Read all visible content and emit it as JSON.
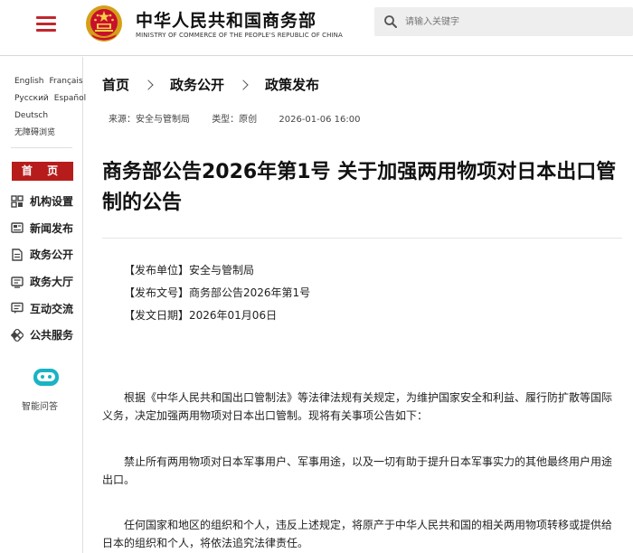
{
  "header": {
    "site_title_cn": "中华人民共和国商务部",
    "site_title_en": "MINISTRY OF COMMERCE OF THE PEOPLE'S REPUBLIC OF CHINA",
    "search_placeholder": "请输入关键字",
    "accent_color": "#c0272d"
  },
  "sidebar": {
    "languages": [
      [
        "English",
        "Français"
      ],
      [
        "Русский",
        "Español"
      ],
      [
        "Deutsch"
      ],
      [
        "无障碍浏览"
      ]
    ],
    "home": "首 页",
    "items": [
      {
        "label": "机构设置",
        "icon": "grid-icon"
      },
      {
        "label": "新闻发布",
        "icon": "newspaper-icon"
      },
      {
        "label": "政务公开",
        "icon": "document-icon"
      },
      {
        "label": "政务大厅",
        "icon": "form-icon"
      },
      {
        "label": "互动交流",
        "icon": "chat-icon"
      },
      {
        "label": "公共服务",
        "icon": "service-icon"
      }
    ],
    "ai_label": "智能问答"
  },
  "breadcrumb": [
    "首页",
    "政务公开",
    "政策发布"
  ],
  "meta": {
    "source": "来源：安全与管制局",
    "type": "类型：原创",
    "date": "2026-01-06 16:00"
  },
  "article": {
    "title": "商务部公告2026年第1号 关于加强两用物项对日本出口管制的公告",
    "info": [
      "【发布单位】安全与管制局",
      "【发布文号】商务部公告2026年第1号",
      "【发文日期】2026年01月06日"
    ],
    "paragraphs": [
      "根据《中华人民共和国出口管制法》等法律法规有关规定，为维护国家安全和利益、履行防扩散等国际义务，决定加强两用物项对日本出口管制。现将有关事项公告如下：",
      "禁止所有两用物项对日本军事用户、军事用途，以及一切有助于提升日本军事实力的其他最终用户用途出口。",
      "任何国家和地区的组织和个人，违反上述规定，将原产于中华人民共和国的相关两用物项转移或提供给日本的组织和个人，将依法追究法律责任。"
    ]
  }
}
